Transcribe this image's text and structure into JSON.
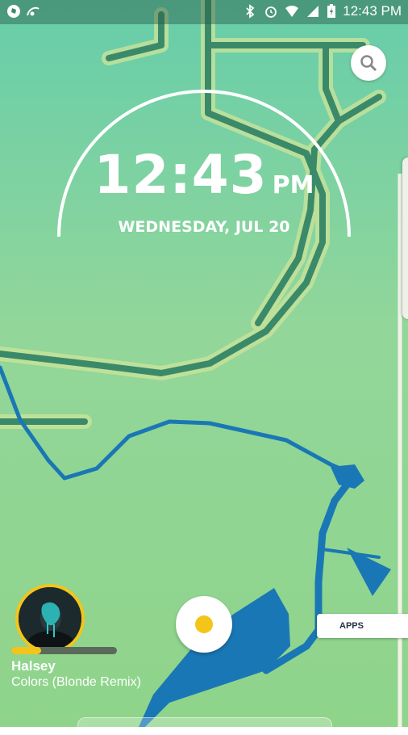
{
  "status_bar": {
    "time": "12:43 PM",
    "left_icons": [
      "music-app-icon",
      "wifi-call-icon"
    ],
    "right_icons": [
      "bluetooth-icon",
      "alarm-icon",
      "wifi-icon",
      "signal-icon",
      "battery-charging-icon"
    ]
  },
  "clock": {
    "time": "12:43",
    "ampm": "PM",
    "date": "WEDNESDAY, JUL 20"
  },
  "music": {
    "artist": "Halsey",
    "song": "Colors (Blonde Remix)",
    "progress": 0.28
  },
  "apps_label": "APPS",
  "colors": {
    "accent": "#f3c51a",
    "map_water": "#1a77b5",
    "map_road": "#3a8a6a"
  }
}
